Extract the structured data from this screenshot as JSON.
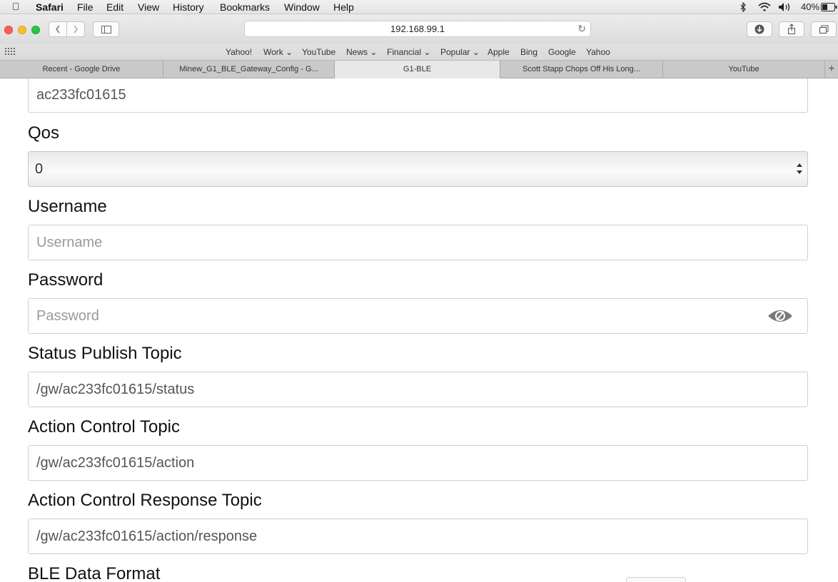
{
  "menubar": {
    "app": "Safari",
    "items": [
      "File",
      "Edit",
      "View",
      "History",
      "Bookmarks",
      "Window",
      "Help"
    ],
    "battery": "40%"
  },
  "toolbar": {
    "url": "192.168.99.1"
  },
  "favorites": [
    "Yahoo!",
    "Work",
    "YouTube",
    "News",
    "Financial",
    "Popular",
    "Apple",
    "Bing",
    "Google",
    "Yahoo"
  ],
  "tabs": [
    {
      "label": "Recent - Google Drive"
    },
    {
      "label": "Minew_G1_BLE_Gateway_Config - G..."
    },
    {
      "label": "G1-BLE"
    },
    {
      "label": "Scott Stapp Chops Off His Long..."
    },
    {
      "label": "YouTube"
    }
  ],
  "form": {
    "client_id_value": "ac233fc01615",
    "qos_label": "Qos",
    "qos_value": "0",
    "username_label": "Username",
    "username_placeholder": "Username",
    "password_label": "Password",
    "password_placeholder": "Password",
    "status_topic_label": "Status Publish Topic",
    "status_topic_value": "/gw/ac233fc01615/status",
    "action_topic_label": "Action Control Topic",
    "action_topic_value": "/gw/ac233fc01615/action",
    "action_response_label": "Action Control Response Topic",
    "action_response_value": "/gw/ac233fc01615/action/response",
    "ble_format_label": "BLE Data Format"
  }
}
